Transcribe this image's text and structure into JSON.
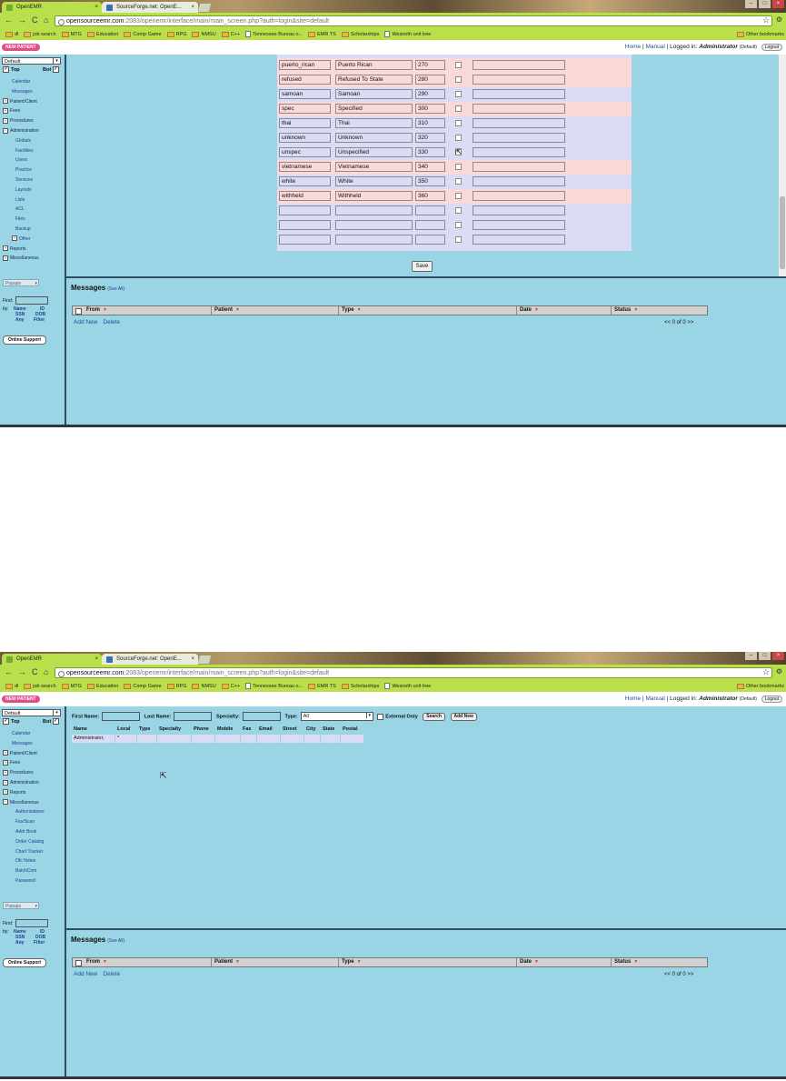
{
  "browser": {
    "tabs": [
      {
        "label": "OpenEMR",
        "close": "×"
      },
      {
        "label": "SourceForge.net: OpenE...",
        "close": "×"
      }
    ],
    "nav": {
      "back": "←",
      "forward": "→",
      "reload": "C",
      "home": "⌂"
    },
    "url_host": "opensourceemr.com",
    "url_path": ":2083/openemr/interface/main/main_screen.php?auth=login&site=default",
    "bookmarks": [
      {
        "label": "dl",
        "kind": "folder"
      },
      {
        "label": "job search",
        "kind": "folder"
      },
      {
        "label": "MTG",
        "kind": "folder"
      },
      {
        "label": "Education",
        "kind": "folder"
      },
      {
        "label": "Comp Game",
        "kind": "folder"
      },
      {
        "label": "RPG",
        "kind": "folder"
      },
      {
        "label": "NMSU",
        "kind": "folder"
      },
      {
        "label": "C++",
        "kind": "folder"
      },
      {
        "label": "Tennessee Bureau o...",
        "kind": "page"
      },
      {
        "label": "EMR TS",
        "kind": "folder"
      },
      {
        "label": "Scholarships",
        "kind": "folder"
      },
      {
        "label": "Wesnoth unit tree",
        "kind": "page"
      }
    ],
    "other_bookmarks": "Other bookmarks"
  },
  "emr_header": {
    "new_patient": "NEW PATIENT",
    "home": "Home",
    "manual": "Manual",
    "logged_in": "| Logged in:",
    "user": "Administrator",
    "site": "(Default)",
    "logout": "Logout"
  },
  "nav1": {
    "select": "Default",
    "top": "Top",
    "bot": "Bot",
    "items": [
      {
        "label": "Calendar",
        "level": "sub"
      },
      {
        "label": "Messages",
        "level": "sub"
      },
      {
        "label": "Patient/Client",
        "level": "top",
        "pm": "+"
      },
      {
        "label": "Fees",
        "level": "top",
        "pm": "+"
      },
      {
        "label": "Procedures",
        "level": "top",
        "pm": "+"
      },
      {
        "label": "Administration",
        "level": "top",
        "pm": "−"
      },
      {
        "label": "Globals",
        "level": "sub2"
      },
      {
        "label": "Facilities",
        "level": "sub2"
      },
      {
        "label": "Users",
        "level": "sub2"
      },
      {
        "label": "Practice",
        "level": "sub2"
      },
      {
        "label": "Services",
        "level": "sub2"
      },
      {
        "label": "Layouts",
        "level": "sub2"
      },
      {
        "label": "Lists",
        "level": "sub2"
      },
      {
        "label": "ACL",
        "level": "sub2"
      },
      {
        "label": "Files",
        "level": "sub2"
      },
      {
        "label": "Backup",
        "level": "sub2"
      },
      {
        "label": "Other",
        "level": "sub",
        "pm": "+"
      },
      {
        "label": "Reports",
        "level": "top",
        "pm": "+"
      },
      {
        "label": "Miscellaneous",
        "level": "top",
        "pm": "+"
      }
    ]
  },
  "nav2": {
    "select": "Default",
    "top": "Top",
    "bot": "Bot",
    "items": [
      {
        "label": "Calendar",
        "level": "sub"
      },
      {
        "label": "Messages",
        "level": "sub"
      },
      {
        "label": "Patient/Client",
        "level": "top",
        "pm": "+"
      },
      {
        "label": "Fees",
        "level": "top",
        "pm": "+"
      },
      {
        "label": "Procedures",
        "level": "top",
        "pm": "+"
      },
      {
        "label": "Administration",
        "level": "top",
        "pm": "+"
      },
      {
        "label": "Reports",
        "level": "top",
        "pm": "+"
      },
      {
        "label": "Miscellaneous",
        "level": "top",
        "pm": "−"
      },
      {
        "label": "Authorizations",
        "level": "sub2"
      },
      {
        "label": "Fax/Scan",
        "level": "sub2"
      },
      {
        "label": "Addr Book",
        "level": "sub2"
      },
      {
        "label": "Order Catalog",
        "level": "sub2"
      },
      {
        "label": "Chart Tracker",
        "level": "sub2"
      },
      {
        "label": "Ofc Notes",
        "level": "sub2"
      },
      {
        "label": "BatchCom",
        "level": "sub2"
      },
      {
        "label": "Password",
        "level": "sub2"
      }
    ]
  },
  "nav_common": {
    "popups": "Popups",
    "find": "Find:",
    "by": "by:",
    "name": "Name",
    "id": "ID",
    "ssn": "SSN",
    "dob": "DOB",
    "any": "Any",
    "filter": "Filter",
    "online_support": "Online Support"
  },
  "list_rows": [
    {
      "id": "puerto_rican",
      "title": "Puerto Rican",
      "order": "270",
      "style": "pink"
    },
    {
      "id": "refused",
      "title": "Refused To State",
      "order": "280",
      "style": "pink"
    },
    {
      "id": "samoan",
      "title": "Samoan",
      "order": "290",
      "style": "blue"
    },
    {
      "id": "spec",
      "title": "Specified",
      "order": "300",
      "style": "pink"
    },
    {
      "id": "thai",
      "title": "Thai",
      "order": "310",
      "style": "blue"
    },
    {
      "id": "unknown",
      "title": "Unknown",
      "order": "320",
      "style": "blue"
    },
    {
      "id": "unspec",
      "title": "Unspecified",
      "order": "330",
      "style": "blue"
    },
    {
      "id": "vietnamese",
      "title": "Vietnamese",
      "order": "340",
      "style": "pink"
    },
    {
      "id": "white",
      "title": "White",
      "order": "350",
      "style": "blue"
    },
    {
      "id": "withheld",
      "title": "Withheld",
      "order": "360",
      "style": "pink"
    },
    {
      "id": "",
      "title": "",
      "order": "",
      "style": "blue"
    },
    {
      "id": "",
      "title": "",
      "order": "",
      "style": "blue"
    },
    {
      "id": "",
      "title": "",
      "order": "",
      "style": "blue"
    }
  ],
  "save_label": "Save",
  "messages": {
    "title": "Messages",
    "see_all": "(See All)",
    "columns": [
      "From",
      "Patient",
      "Type",
      "Date",
      "Status"
    ],
    "add_new": "Add New",
    "delete": "Delete",
    "pager": "<<  0 of 0  >>"
  },
  "addrbook": {
    "first_name": "First Name:",
    "last_name": "Last Name:",
    "specialty": "Specialty:",
    "type": "Type:",
    "type_value": "All",
    "external_only": "External Only",
    "search": "Search",
    "add_new": "Add New",
    "columns": [
      "Name",
      "Local",
      "Type",
      "Specialty",
      "Phone",
      "Mobile",
      "Fax",
      "Email",
      "Street",
      "City",
      "State",
      "Postal"
    ],
    "rows": [
      [
        "Administrator,",
        "*",
        "",
        "",
        "",
        "",
        "",
        "",
        "",
        "",
        "",
        ""
      ]
    ]
  },
  "colors": {
    "content_bg": "#9ad5e6",
    "chrome_green": "#b9df4a",
    "row_pink": "#fbd9d9",
    "row_blue": "#d9dcf4",
    "link": "#1e4f9b",
    "new_patient": "#e34b8b"
  },
  "icons": {
    "star": "☆",
    "wrench": "🔧",
    "cursor": "⇱",
    "sort_arrow": "▼",
    "dropdown": "▾"
  }
}
